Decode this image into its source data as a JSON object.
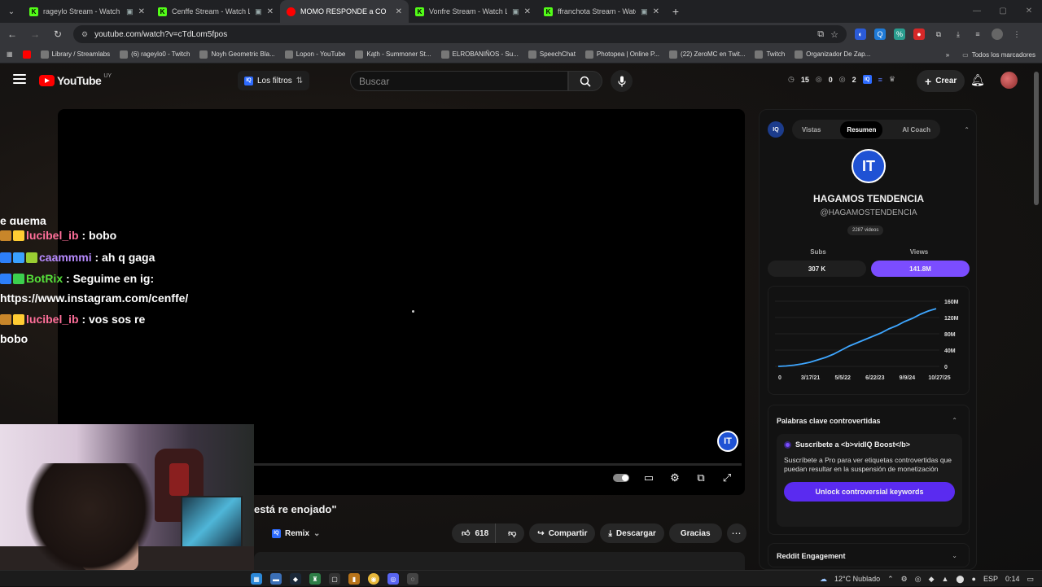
{
  "browser": {
    "tabs": [
      {
        "title": "rageylo Stream - Watch Live",
        "favicon": "kick"
      },
      {
        "title": "Cenffe Stream - Watch Live",
        "favicon": "kick"
      },
      {
        "title": "MOMO RESPONDE a COSCU: ",
        "favicon": "youtube",
        "active": true
      },
      {
        "title": "Vonfre Stream - Watch Live",
        "favicon": "kick"
      },
      {
        "title": "ffranchota Stream - Watch Live",
        "favicon": "kick"
      }
    ],
    "url": "youtube.com/watch?v=cTdLom5fpos",
    "bookmarks": [
      "Library / Streamlabs",
      "(6) rageylo0 - Twitch",
      "Noyh Geometric Bla...",
      "Lopon - YouTube",
      "Kąth - Summoner St...",
      "ELROBANIÑOS - Su...",
      "SpeechChat",
      "Photopea | Online P...",
      "(22) ZeroMC en Twit...",
      "Twitch",
      "Organizador De Zap..."
    ],
    "all_bookmarks": "Todos los marcadores"
  },
  "youtube": {
    "logo": "YouTube",
    "country": "UY",
    "filters_label": "Los filtros",
    "search_placeholder": "Buscar",
    "stats": {
      "views": "15",
      "eye": "0",
      "third": "2"
    },
    "create_label": "Crear"
  },
  "chat": [
    {
      "user": "",
      "msg": "e quema",
      "cut": true
    },
    {
      "user": "lucibel_ib",
      "msg": " : bobo",
      "color": "pink"
    },
    {
      "user": "caammmi",
      "msg": " : ah q gaga",
      "color": "purple"
    },
    {
      "user": "BotRix",
      "msg": " : Seguime en ig: https://www.instagram.com/cenffe/",
      "color": "green"
    },
    {
      "user": "lucibel_ib",
      "msg": " : vos sos re bobo",
      "color": "pink"
    }
  ],
  "video": {
    "title_visible": "está re enojado\"",
    "remix_label": "Remix",
    "likes": "618",
    "share_label": "Compartir",
    "download_label": "Descargar",
    "thanks_label": "Gracias"
  },
  "vidiq": {
    "tabs": [
      "Vistas",
      "Resumen",
      "AI Coach"
    ],
    "active_tab": "Resumen",
    "channel_logo": "IT",
    "channel_name": "HAGAMOS TENDENCIA",
    "handle": "@HAGAMOSTENDENCIA",
    "videos": "2287 videos",
    "subs_label": "Subs",
    "views_label": "Views",
    "subs_value": "307 K",
    "views_value": "141.8M",
    "keywords_title": "Palabras clave controvertidas",
    "keywords_promo_title": "Suscríbete a <b>vidIQ Boost</b>",
    "keywords_body": "Suscríbete a Pro para ver etiquetas controvertidas que puedan resultar en la suspensión de monetización",
    "unlock_label": "Unlock controversial keywords",
    "reddit_title": "Reddit Engagement"
  },
  "chart_data": {
    "type": "line",
    "x_ticks": [
      "0",
      "3/17/21",
      "5/5/22",
      "6/22/23",
      "9/9/24",
      "10/27/25"
    ],
    "y_ticks": [
      "0",
      "40M",
      "80M",
      "120M",
      "160M"
    ],
    "ylim": [
      0,
      160
    ],
    "series": [
      {
        "values": [
          0,
          1,
          3,
          6,
          10,
          16,
          22,
          30,
          40,
          50,
          58,
          66,
          74,
          82,
          92,
          100,
          110,
          118,
          128,
          136,
          141.8
        ]
      }
    ],
    "color": "#3ea6ff"
  },
  "taskbar": {
    "weather": "12°C Nublado",
    "lang": "ESP",
    "time": "0:14"
  }
}
